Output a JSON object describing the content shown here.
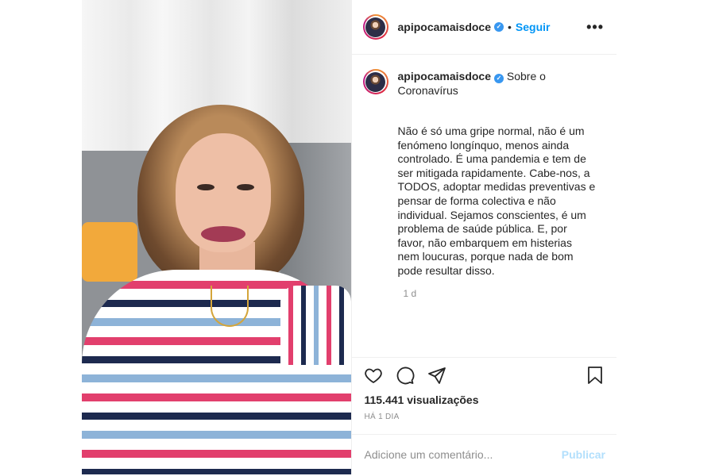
{
  "header": {
    "username": "apipocamaisdoce",
    "follow_label": "Seguir",
    "separator": "•",
    "more_label": "•••"
  },
  "caption": {
    "username": "apipocamaisdoce",
    "title": "Sobre o Coronavírus",
    "text": "Não é só uma gripe normal, não é um fenómeno longínquo, menos ainda controlado. É uma pandemia e tem de ser mitigada rapidamente. Cabe-nos, a TODOS, adoptar medidas preventivas e pensar de forma colectiva e não individual. Sejamos conscientes, é um problema de saúde pública. E, por favor, não embarquem em histerias nem loucuras, porque nada de bom pode resultar disso.",
    "time": "1 d"
  },
  "actions": {
    "like_icon": "heart-icon",
    "comment_icon": "comment-icon",
    "share_icon": "share-icon",
    "save_icon": "bookmark-icon"
  },
  "stats": {
    "views": "115.441 visualizações",
    "posted_ago": "HÁ 1 DIA"
  },
  "comment": {
    "placeholder": "Adicione um comentário...",
    "publish_label": "Publicar"
  },
  "colors": {
    "link_blue": "#0095f6",
    "verified_blue": "#3897f0",
    "publish_disabled": "#b2dffc",
    "muted_text": "#8e8e8e"
  }
}
